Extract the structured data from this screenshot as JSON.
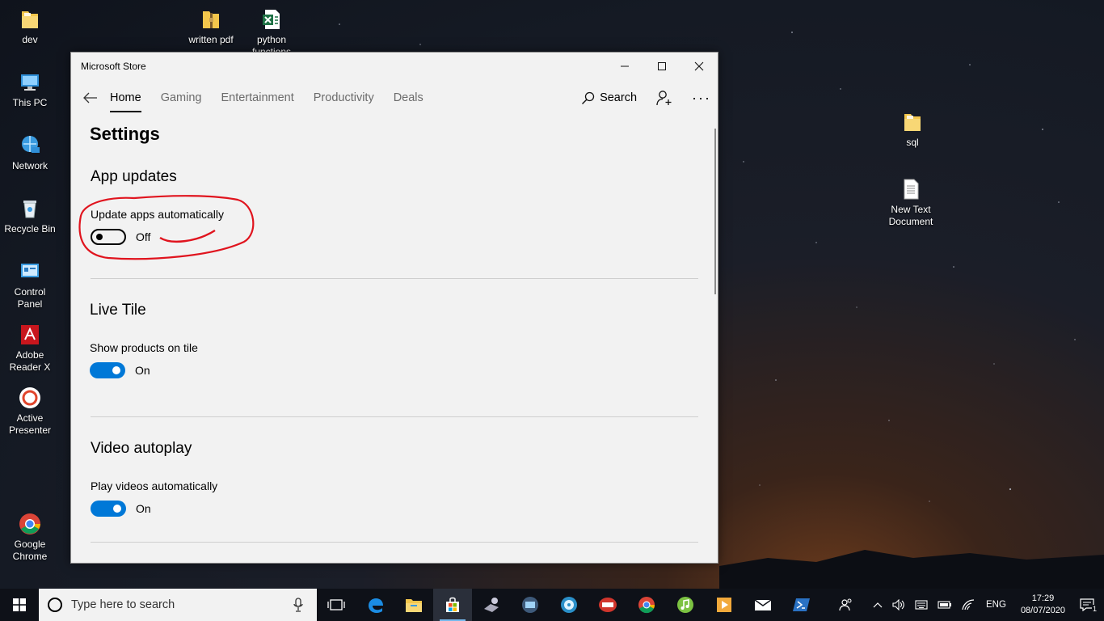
{
  "desktop": {
    "icons_left": [
      {
        "label": "dev",
        "icon": "folder-icon"
      },
      {
        "label": "This PC",
        "icon": "this-pc-icon"
      },
      {
        "label": "Network",
        "icon": "network-icon"
      },
      {
        "label": "Recycle Bin",
        "icon": "recycle-bin-icon"
      },
      {
        "label": "Control Panel",
        "icon": "control-panel-icon"
      },
      {
        "label": "Adobe Reader X",
        "icon": "adobe-reader-icon"
      },
      {
        "label": "Active Presenter",
        "icon": "active-presenter-icon"
      },
      {
        "label": "Google Chrome",
        "icon": "chrome-icon"
      }
    ],
    "icons_top": [
      {
        "label": "written pdf",
        "icon": "zip-folder-icon"
      },
      {
        "label": "python functions",
        "icon": "excel-file-icon"
      }
    ],
    "icons_right": [
      {
        "label": "sql",
        "icon": "folder-icon"
      },
      {
        "label": "New Text Document",
        "icon": "text-document-icon"
      }
    ]
  },
  "window": {
    "title": "Microsoft Store",
    "nav": {
      "tabs": [
        {
          "label": "Home",
          "active": true
        },
        {
          "label": "Gaming",
          "active": false
        },
        {
          "label": "Entertainment",
          "active": false
        },
        {
          "label": "Productivity",
          "active": false
        },
        {
          "label": "Deals",
          "active": false
        }
      ],
      "search_label": "Search"
    },
    "settings": {
      "heading": "Settings",
      "sections": [
        {
          "title": "App updates",
          "label": "Update apps automatically",
          "state": "Off",
          "on": false
        },
        {
          "title": "Live Tile",
          "label": "Show products on tile",
          "state": "On",
          "on": true
        },
        {
          "title": "Video autoplay",
          "label": "Play videos automatically",
          "state": "On",
          "on": true
        }
      ]
    }
  },
  "taskbar": {
    "search_placeholder": "Type here to search",
    "language": "ENG",
    "time": "17:29",
    "date": "08/07/2020",
    "notification_count": "1"
  },
  "colors": {
    "accent": "#0078d7",
    "annotation": "#e0141e"
  }
}
